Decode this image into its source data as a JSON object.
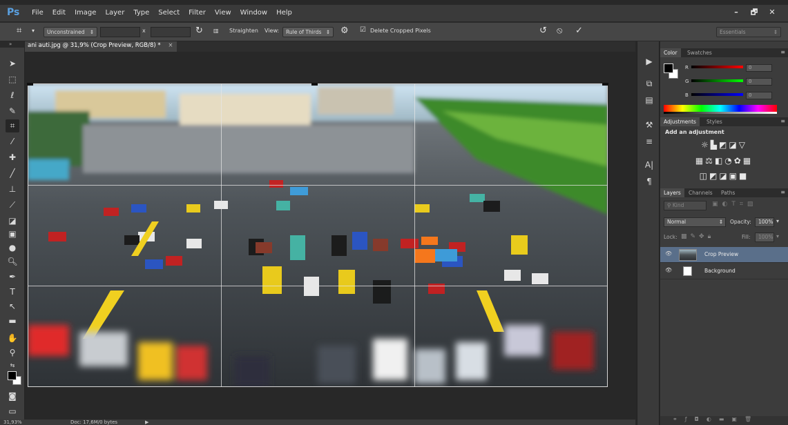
{
  "app": {
    "logo": "Ps",
    "menu": [
      "File",
      "Edit",
      "Image",
      "Layer",
      "Type",
      "Select",
      "Filter",
      "View",
      "Window",
      "Help"
    ],
    "window_controls": {
      "minimize": "–",
      "restore": "🗗",
      "close": "✕"
    }
  },
  "options_bar": {
    "ratio_preset": "Unconstrained",
    "swap_symbol": "x",
    "straighten_label": "Straighten",
    "view_label": "View:",
    "view_value": "Rule of Thirds",
    "delete_cropped_label": "Delete Cropped Pixels",
    "delete_cropped_checked": true,
    "workspace": "Essentials"
  },
  "document": {
    "tab_title": "ani auti.jpg @ 31,9% (Crop Preview, RGB/8) *",
    "tab_close": "×"
  },
  "status_bar": {
    "zoom": "31,93%",
    "doc_info": "Doc: 17,6M/0 bytes"
  },
  "color_panel": {
    "tabs": [
      "Color",
      "Swatches"
    ],
    "channels": [
      {
        "label": "R",
        "value": "0",
        "color": "#ff0000"
      },
      {
        "label": "G",
        "value": "0",
        "color": "#00ff00"
      },
      {
        "label": "B",
        "value": "0",
        "color": "#0000ff"
      }
    ],
    "foreground": "#000000",
    "background": "#ffffff"
  },
  "adjustments_panel": {
    "tabs": [
      "Adjustments",
      "Styles"
    ],
    "heading": "Add an adjustment",
    "icon_rows": [
      [
        "brightness-icon",
        "levels-icon",
        "curves-icon",
        "exposure-icon",
        "vibrance-icon"
      ],
      [
        "hue-saturation-icon",
        "color-balance-icon",
        "black-white-icon",
        "photo-filter-icon",
        "channel-mixer-icon",
        "color-lookup-icon"
      ],
      [
        "invert-icon",
        "posterize-icon",
        "threshold-icon",
        "gradient-map-icon",
        "selective-color-icon"
      ]
    ]
  },
  "layers_panel": {
    "tabs": [
      "Layers",
      "Channels",
      "Paths"
    ],
    "filter_kind": "Kind",
    "blend_mode": "Normal",
    "opacity_label": "Opacity:",
    "opacity_value": "100%",
    "lock_label": "Lock:",
    "fill_label": "Fill:",
    "fill_value": "100%",
    "layers": [
      {
        "name": "Crop Preview",
        "selected": true
      },
      {
        "name": "Background",
        "selected": false
      }
    ]
  }
}
